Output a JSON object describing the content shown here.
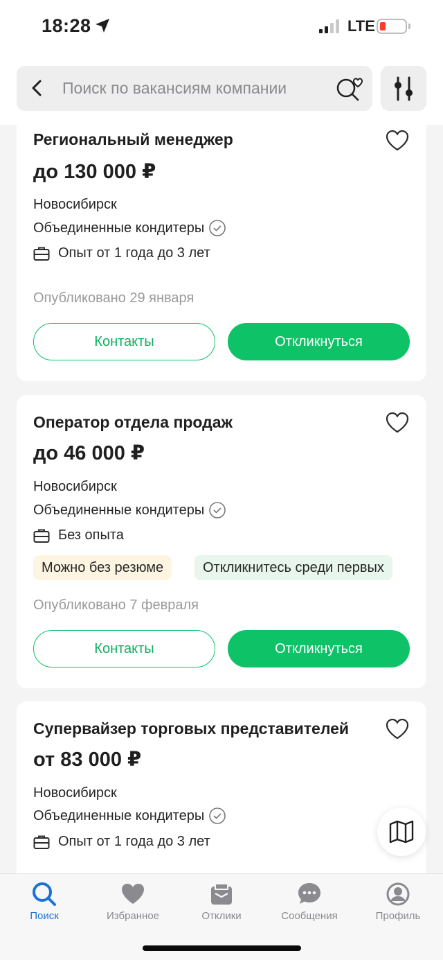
{
  "status_bar": {
    "time": "18:28",
    "network": "LTE"
  },
  "header": {
    "search_placeholder": "Поиск по вакансиям компании"
  },
  "vacancies": [
    {
      "title": "Региональный менеджер",
      "salary": "до 130 000 ₽",
      "city": "Новосибирск",
      "company": "Объединенные кондитеры",
      "experience": "Опыт от 1 года до 3 лет",
      "published": "Опубликовано 29 января",
      "contacts_label": "Контакты",
      "respond_label": "Откликнуться"
    },
    {
      "title": "Оператор отдела продаж",
      "salary": "до 46 000 ₽",
      "city": "Новосибирск",
      "company": "Объединенные кондитеры",
      "experience": "Без опыта",
      "tags": [
        "Можно без резюме",
        "Откликнитесь среди первых"
      ],
      "published": "Опубликовано 7 февраля",
      "contacts_label": "Контакты",
      "respond_label": "Откликнуться"
    },
    {
      "title": "Супервайзер торговых представителей",
      "salary": "от 83 000 ₽",
      "city": "Новосибирск",
      "company": "Объединенные кондитеры",
      "experience": "Опыт от 1 года до 3 лет"
    }
  ],
  "tab_bar": {
    "items": [
      {
        "label": "Поиск",
        "icon": "search-icon",
        "active": true
      },
      {
        "label": "Избранное",
        "icon": "heart-icon",
        "active": false
      },
      {
        "label": "Отклики",
        "icon": "responses-icon",
        "active": false
      },
      {
        "label": "Сообщения",
        "icon": "chat-icon",
        "active": false
      },
      {
        "label": "Профиль",
        "icon": "profile-icon",
        "active": false
      }
    ]
  },
  "colors": {
    "accent_green": "#0dc267",
    "accent_blue": "#1b73d8"
  }
}
